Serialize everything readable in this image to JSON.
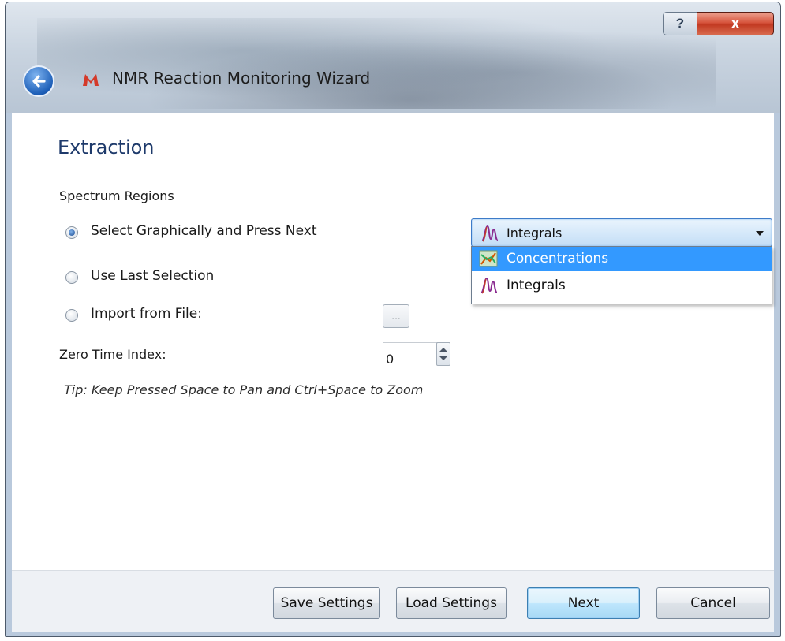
{
  "window": {
    "title": "NMR Reaction Monitoring Wizard",
    "help_glyph": "?",
    "close_glyph": "x"
  },
  "page": {
    "heading": "Extraction",
    "section_label": "Spectrum Regions",
    "options": [
      {
        "label": "Select Graphically and Press Next",
        "checked": true
      },
      {
        "label": "Use Last Selection",
        "checked": false
      },
      {
        "label": "Import from File:",
        "checked": false
      }
    ],
    "browse_label": "...",
    "zero_time_label": "Zero Time Index:",
    "zero_time_value": "0",
    "tip": "Tip: Keep Pressed Space to Pan and Ctrl+Space to Zoom"
  },
  "combo": {
    "selected": "Integrals",
    "options": [
      {
        "label": "Concentrations",
        "icon": "concentrations-icon",
        "highlighted": true
      },
      {
        "label": "Integrals",
        "icon": "integrals-icon",
        "highlighted": false
      }
    ]
  },
  "footer": {
    "save_settings": "Save Settings",
    "load_settings": "Load Settings",
    "next": "Next",
    "cancel": "Cancel"
  },
  "colors": {
    "heading": "#1e3a6b",
    "highlight": "#3399ff",
    "close_button": "#c23a22"
  }
}
